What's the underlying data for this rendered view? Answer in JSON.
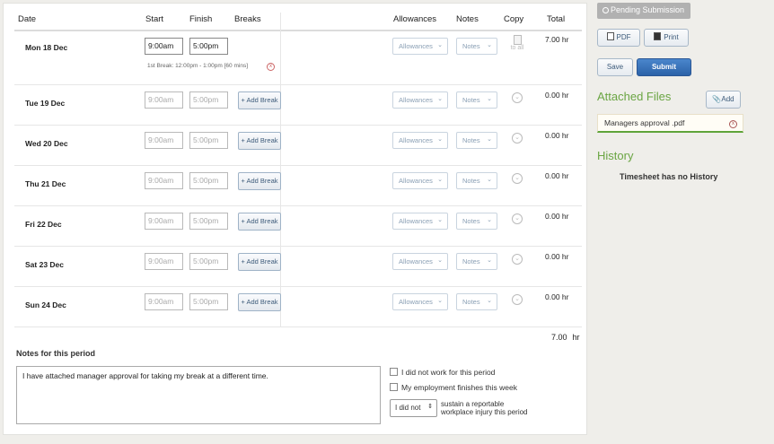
{
  "columns": {
    "date": "Date",
    "start": "Start",
    "finish": "Finish",
    "breaks": "Breaks",
    "allowances": "Allowances",
    "notes": "Notes",
    "copy": "Copy",
    "total": "Total"
  },
  "rows": [
    {
      "day": "Mon 18 Dec",
      "start": "9:00am",
      "finish": "5:00pm",
      "total": "7.00 hr",
      "break_note": "1st Break: 12:00pm - 1:00pm [60 mins]",
      "copy_label": "to all"
    },
    {
      "day": "Tue 19 Dec",
      "start": "9:00am",
      "finish": "5:00pm",
      "total": "0.00 hr"
    },
    {
      "day": "Wed 20 Dec",
      "start": "9:00am",
      "finish": "5:00pm",
      "total": "0.00 hr"
    },
    {
      "day": "Thu 21 Dec",
      "start": "9:00am",
      "finish": "5:00pm",
      "total": "0.00 hr"
    },
    {
      "day": "Fri 22 Dec",
      "start": "9:00am",
      "finish": "5:00pm",
      "total": "0.00 hr"
    },
    {
      "day": "Sat 23 Dec",
      "start": "9:00am",
      "finish": "5:00pm",
      "total": "0.00 hr"
    },
    {
      "day": "Sun 24 Dec",
      "start": "9:00am",
      "finish": "5:00pm",
      "total": "0.00 hr"
    }
  ],
  "controls": {
    "add_break": "+ Add Break",
    "allowances": "Allowances",
    "notes": "Notes"
  },
  "grand_total": {
    "value": "7.00",
    "unit": "hr"
  },
  "period_notes": {
    "label": "Notes for this period",
    "text": "I have attached manager approval for taking my break at a different time."
  },
  "checks": {
    "did_not_work": "I did not work for this period",
    "employment_finishes": "My employment finishes this week"
  },
  "injury": {
    "select_value": "I did not",
    "line1": "sustain a reportable",
    "line2": "workplace injury this period"
  },
  "sidebar": {
    "status": "Pending Submission",
    "pdf": "PDF",
    "print": "Print",
    "save": "Save",
    "submit": "Submit",
    "attached_title": "Attached Files",
    "add": "Add",
    "file_name": "Managers approval .pdf",
    "history_title": "History",
    "no_history": "Timesheet has no History"
  },
  "colors": {
    "accent_green": "#6aa543",
    "primary_blue": "#2b62a8",
    "status_grey": "#b1b1b1"
  }
}
